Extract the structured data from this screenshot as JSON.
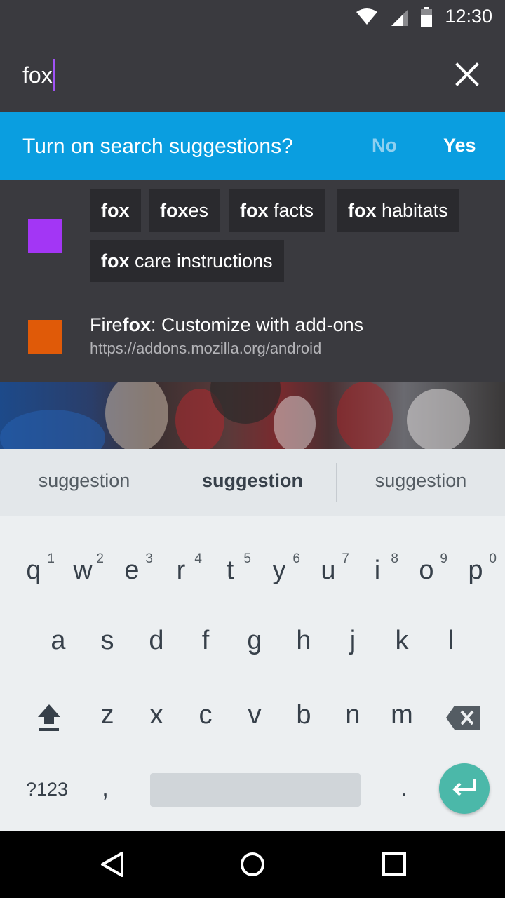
{
  "status_bar": {
    "time": "12:30"
  },
  "url_bar": {
    "query": "fox"
  },
  "prompt": {
    "text": "Turn on search suggestions?",
    "no": "No",
    "yes": "Yes"
  },
  "search_suggestions": [
    {
      "bold": "fox",
      "rest": ""
    },
    {
      "bold": "fox",
      "rest": "es"
    },
    {
      "bold": "fox",
      "rest": " facts"
    },
    {
      "bold": "fox",
      "rest": " habitats"
    },
    {
      "bold": "fox",
      "rest": " care instructions"
    }
  ],
  "history_item": {
    "title_prefix": "Fire",
    "title_bold": "fox",
    "title_suffix": ": Customize with add-ons",
    "url": "https://addons.mozilla.org/android"
  },
  "keyboard": {
    "suggestions": [
      "suggestion",
      "suggestion",
      "suggestion"
    ],
    "row1": [
      "q",
      "w",
      "e",
      "r",
      "t",
      "y",
      "u",
      "i",
      "o",
      "p"
    ],
    "row1_hints": [
      "1",
      "2",
      "3",
      "4",
      "5",
      "6",
      "7",
      "8",
      "9",
      "0"
    ],
    "row2": [
      "a",
      "s",
      "d",
      "f",
      "g",
      "h",
      "j",
      "k",
      "l"
    ],
    "row3": [
      "z",
      "x",
      "c",
      "v",
      "b",
      "n",
      "m"
    ],
    "symbols_key": "?123",
    "comma_key": ",",
    "period_key": "."
  },
  "colors": {
    "toolbar": "#3a3a3f",
    "prompt_bg": "#0a9ee0",
    "engine_icon": "#a336f5",
    "history_icon": "#e05a08",
    "enter_key": "#4bb8a9"
  }
}
